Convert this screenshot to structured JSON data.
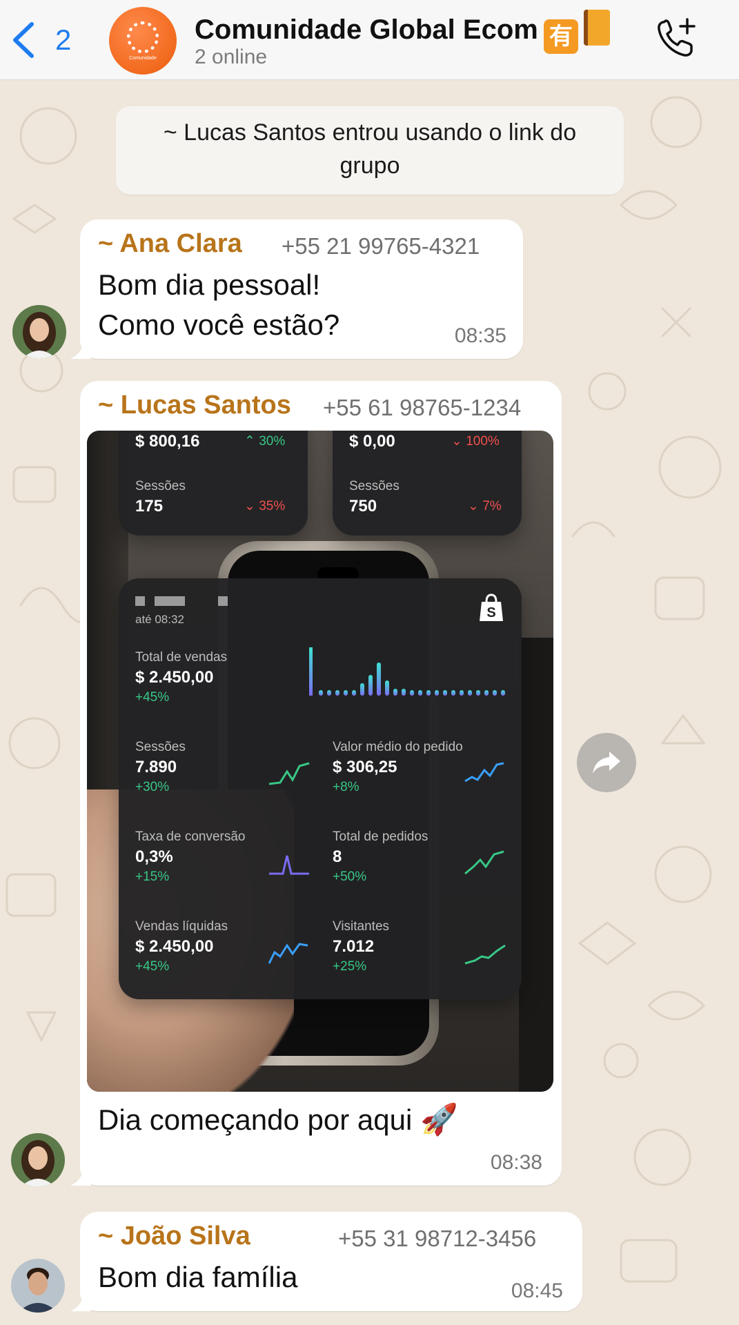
{
  "header": {
    "back_count": "2",
    "group_name": "Comunidade Global Ecom",
    "badge_kanji": "有",
    "status": "2 online",
    "avatar_caption": "Comunidade",
    "accent": "#1f7cf0"
  },
  "system_message": "~ Lucas Santos entrou usando o link do grupo",
  "messages": [
    {
      "sender": "~ Ana Clara",
      "phone": "+55 21 99765-4321",
      "lines": [
        "Bom dia pessoal!",
        "Como você estão?"
      ],
      "time": "08:35"
    },
    {
      "sender": "~ Lucas Santos",
      "phone": "+55 61 98765-1234",
      "caption": "Dia começando por aqui",
      "caption_emoji": "🚀",
      "time": "08:38"
    },
    {
      "sender": "~ João Silva",
      "phone": "+55 31 98712-3456",
      "lines": [
        "Bom dia família"
      ],
      "time": "08:45"
    }
  ],
  "image": {
    "top_left": {
      "value": "$ 800,16",
      "value_delta": "30%",
      "label": "Sessões",
      "label_value": "175",
      "label_delta": "35%"
    },
    "top_right": {
      "value": "$ 0,00",
      "value_delta": "100%",
      "label": "Sessões",
      "label_value": "750",
      "label_delta": "7%"
    },
    "main": {
      "until": "até 08:32",
      "total_vendas": {
        "label": "Total de vendas",
        "value": "$ 2.450,00",
        "delta": "+45%"
      },
      "sessoes": {
        "label": "Sessões",
        "value": "7.890",
        "delta": "+30%"
      },
      "valor_medio": {
        "label": "Valor médio do pedido",
        "value": "$ 306,25",
        "delta": "+8%"
      },
      "taxa_conversao": {
        "label": "Taxa de conversão",
        "value": "0,3%",
        "delta": "+15%"
      },
      "total_pedidos": {
        "label": "Total de pedidos",
        "value": "8",
        "delta": "+50%"
      },
      "vendas_liquidas": {
        "label": "Vendas líquidas",
        "value": "$ 2.450,00",
        "delta": "+45%"
      },
      "visitantes": {
        "label": "Visitantes",
        "value": "7.012",
        "delta": "+25%"
      }
    }
  },
  "colors": {
    "sender_name": "#b8741a",
    "positive": "#38c886",
    "negative": "#f0504d",
    "chat_bg": "#efe7dc"
  }
}
